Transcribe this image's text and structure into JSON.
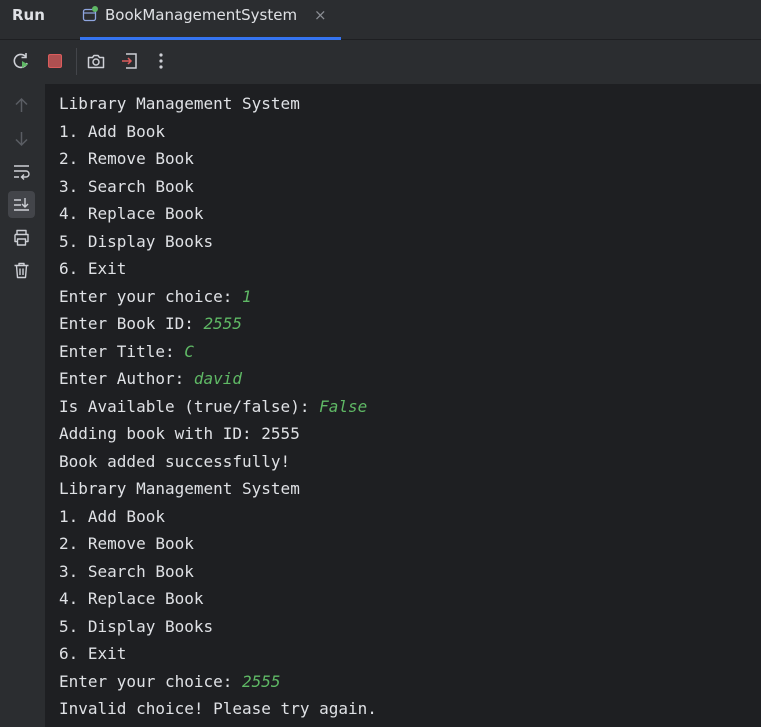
{
  "header": {
    "run_label": "Run",
    "tab_title": "BookManagementSystem",
    "tab_close": "×"
  },
  "toolbar": {
    "buttons": [
      "rerun-icon",
      "stop-icon",
      "screenshot-icon",
      "exit-icon",
      "more-icon"
    ]
  },
  "sidebar": {
    "buttons": [
      "arrow-up-icon",
      "arrow-down-icon",
      "soft-wrap-icon",
      "scroll-to-end-icon",
      "print-icon",
      "trash-icon"
    ]
  },
  "console": {
    "lines": [
      {
        "text": "Library Management System",
        "input": ""
      },
      {
        "text": "1. Add Book",
        "input": ""
      },
      {
        "text": "2. Remove Book",
        "input": ""
      },
      {
        "text": "3. Search Book",
        "input": ""
      },
      {
        "text": "4. Replace Book",
        "input": ""
      },
      {
        "text": "5. Display Books",
        "input": ""
      },
      {
        "text": "6. Exit",
        "input": ""
      },
      {
        "text": "Enter your choice: ",
        "input": "1"
      },
      {
        "text": "Enter Book ID: ",
        "input": "2555"
      },
      {
        "text": "Enter Title: ",
        "input": "C"
      },
      {
        "text": "Enter Author: ",
        "input": "david"
      },
      {
        "text": "Is Available (true/false): ",
        "input": "False"
      },
      {
        "text": "Adding book with ID: 2555",
        "input": ""
      },
      {
        "text": "Book added successfully!",
        "input": ""
      },
      {
        "text": "Library Management System",
        "input": ""
      },
      {
        "text": "1. Add Book",
        "input": ""
      },
      {
        "text": "2. Remove Book",
        "input": ""
      },
      {
        "text": "3. Search Book",
        "input": ""
      },
      {
        "text": "4. Replace Book",
        "input": ""
      },
      {
        "text": "5. Display Books",
        "input": ""
      },
      {
        "text": "6. Exit",
        "input": ""
      },
      {
        "text": "Enter your choice: ",
        "input": "2555"
      },
      {
        "text": "Invalid choice! Please try again.",
        "input": ""
      }
    ]
  },
  "colors": {
    "background": "#1e1f22",
    "panel": "#2b2d30",
    "accent": "#3574f0",
    "user_input": "#5fb865",
    "stop": "#db5c5c"
  }
}
